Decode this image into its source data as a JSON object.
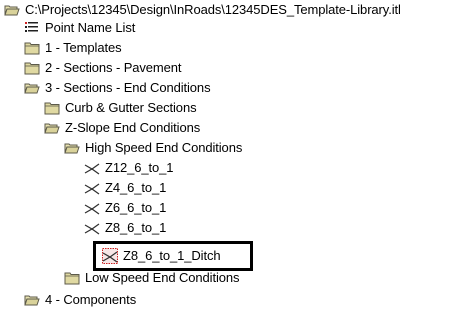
{
  "tree": {
    "root": {
      "label": "C:\\Projects\\12345\\Design\\InRoads\\12345DES_Template-Library.itl",
      "icon": "open-folder-icon"
    },
    "items": [
      {
        "label": "Point Name List",
        "icon": "point-list-icon"
      },
      {
        "label": "1 - Templates",
        "icon": "folder-icon"
      },
      {
        "label": "2 - Sections - Pavement",
        "icon": "folder-icon"
      },
      {
        "label": "3 - Sections - End Conditions",
        "icon": "open-folder-icon"
      },
      {
        "label": "Curb & Gutter Sections",
        "icon": "folder-icon"
      },
      {
        "label": "Z-Slope End Conditions",
        "icon": "open-folder-icon"
      },
      {
        "label": "High Speed End Conditions",
        "icon": "open-folder-icon"
      },
      {
        "label": "Z12_6_to_1",
        "icon": "end-condition-template-icon"
      },
      {
        "label": "Z4_6_to_1",
        "icon": "end-condition-template-icon"
      },
      {
        "label": "Z6_6_to_1",
        "icon": "end-condition-template-icon"
      },
      {
        "label": "Z8_6_to_1",
        "icon": "end-condition-template-icon"
      },
      {
        "label": "Z8_6_to_1_Ditch",
        "icon": "ditch-template-icon",
        "selected": true
      },
      {
        "label": "Low Speed End Conditions",
        "icon": "folder-icon"
      },
      {
        "label": "4 - Components",
        "icon": "open-folder-icon"
      }
    ]
  },
  "colors": {
    "folder_fill": "#d9d29a",
    "folder_outline": "#5c5a4a",
    "highlight_border": "#000000",
    "ditch_icon_red": "#cc2020"
  }
}
